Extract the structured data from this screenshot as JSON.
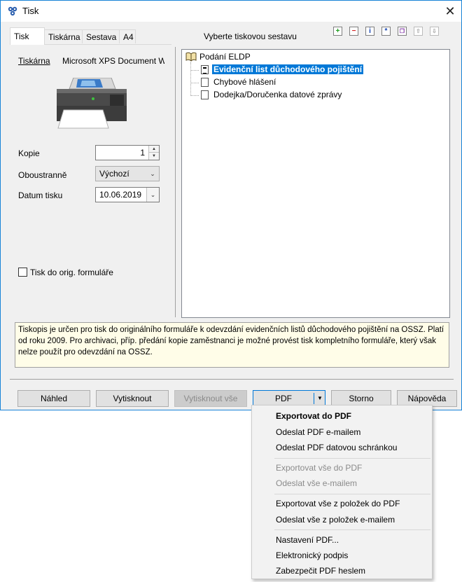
{
  "window": {
    "title": "Tisk",
    "close_glyph": "✕"
  },
  "tabs": [
    {
      "label": "Tisk",
      "active": true
    },
    {
      "label": "Tiskárna",
      "active": false
    },
    {
      "label": "Sestava",
      "active": false
    },
    {
      "label": "A4",
      "active": false
    }
  ],
  "print_tab": {
    "printer_label": "Tiskárna",
    "printer_value": "Microsoft XPS Document W",
    "copies_label": "Kopie",
    "copies_value": "1",
    "duplex_label": "Oboustranně",
    "duplex_value": "Výchozí",
    "date_label": "Datum tisku",
    "date_value": "10.06.2019",
    "orig_form_label": "Tisk do orig. formuláře",
    "orig_form_checked": false
  },
  "report_panel": {
    "title": "Vyberte tiskovou sestavu",
    "toolbar_icons": [
      "add-icon",
      "remove-icon",
      "info-icon",
      "star-icon",
      "copy-icon",
      "move-up-icon",
      "move-down-icon"
    ],
    "tree": {
      "root": "Podání ELDP",
      "items": [
        {
          "label": "Evidenční list důchodového pojištění",
          "selected": true
        },
        {
          "label": "Chybové hlášení",
          "selected": false
        },
        {
          "label": "Dodejka/Doručenka datové zprávy",
          "selected": false
        }
      ]
    }
  },
  "info_text": "Tiskopis je určen pro tisk do originálního formuláře k odevzdání evidenčních listů důchodového pojištění na OSSZ. Platí od roku 2009. Pro archivaci, příp. předání kopie zaměstnanci je možné provést tisk kompletního formuláře, který však nelze použít pro odevzdání na OSSZ.",
  "buttons": {
    "preview": "Náhled",
    "print": "Vytisknout",
    "print_all": "Vytisknout vše",
    "pdf": "PDF",
    "cancel": "Storno",
    "help": "Nápověda"
  },
  "pdf_menu": {
    "group1": [
      "Exportovat do PDF",
      "Odeslat PDF e-mailem",
      "Odeslat PDF datovou schránkou"
    ],
    "group2": [
      "Exportovat vše do PDF",
      "Odeslat vše e-mailem"
    ],
    "group3": [
      "Exportovat vše z položek do PDF",
      "Odeslat vše z položek e-mailem"
    ],
    "group4": [
      "Nastavení PDF...",
      "Elektronický podpis",
      "Zabezpečit PDF heslem"
    ]
  },
  "colors": {
    "accent": "#0078d7",
    "info_bg": "#fffde8",
    "window_bg": "#f0f0f0"
  }
}
